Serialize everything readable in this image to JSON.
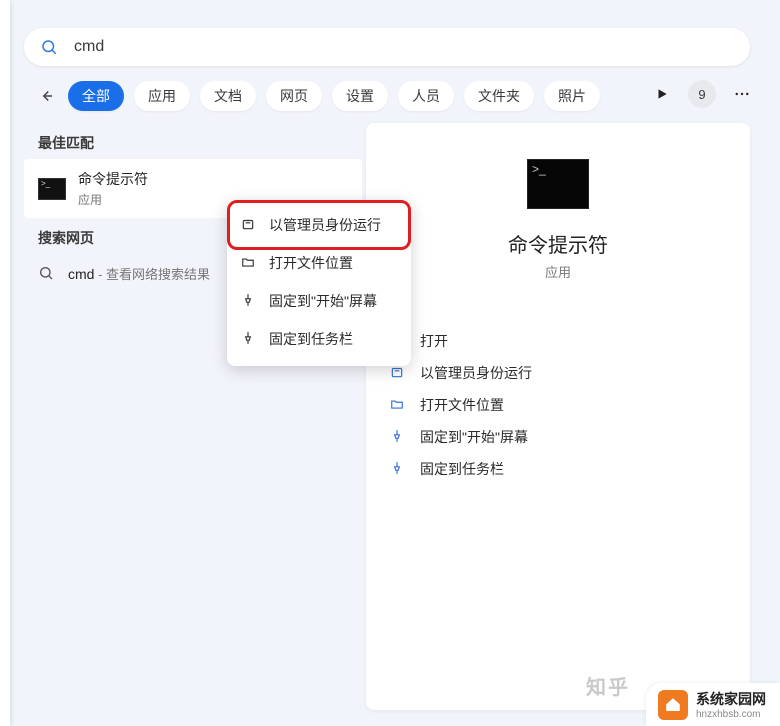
{
  "search": {
    "value": "cmd",
    "placeholder": ""
  },
  "filters": {
    "chips": [
      "全部",
      "应用",
      "文档",
      "网页",
      "设置",
      "人员",
      "文件夹",
      "照片"
    ],
    "active_index": 0,
    "count_badge": "9"
  },
  "sections": {
    "best_match": "最佳匹配",
    "search_web": "搜索网页"
  },
  "best_match": {
    "title": "命令提示符",
    "subtitle": "应用"
  },
  "web_result": {
    "term": "cmd",
    "suffix": " - 查看网络搜索结果"
  },
  "preview": {
    "title": "命令提示符",
    "subtitle": "应用",
    "actions": [
      {
        "key": "open",
        "label": "打开",
        "icon": "none"
      },
      {
        "key": "run-admin",
        "label": "以管理员身份运行",
        "icon": "shield"
      },
      {
        "key": "open-location",
        "label": "打开文件位置",
        "icon": "folder"
      },
      {
        "key": "pin-start",
        "label": "固定到\"开始\"屏幕",
        "icon": "pin"
      },
      {
        "key": "pin-taskbar",
        "label": "固定到任务栏",
        "icon": "pin"
      }
    ]
  },
  "context_menu": {
    "items": [
      {
        "key": "run-admin",
        "label": "以管理员身份运行",
        "icon": "shield"
      },
      {
        "key": "open-location",
        "label": "打开文件位置",
        "icon": "folder"
      },
      {
        "key": "pin-start",
        "label": "固定到\"开始\"屏幕",
        "icon": "pin"
      },
      {
        "key": "pin-taskbar",
        "label": "固定到任务栏",
        "icon": "pin"
      }
    ]
  },
  "watermarks": {
    "zhihu": "知乎",
    "site_title": "系统家园网",
    "site_domain": "hnzxhbsb.com"
  },
  "icons": {
    "search": "search-icon",
    "back": "back-arrow-icon",
    "play": "play-icon",
    "more": "more-icon",
    "shield": "shield-icon",
    "folder": "folder-icon",
    "pin": "pin-icon"
  }
}
